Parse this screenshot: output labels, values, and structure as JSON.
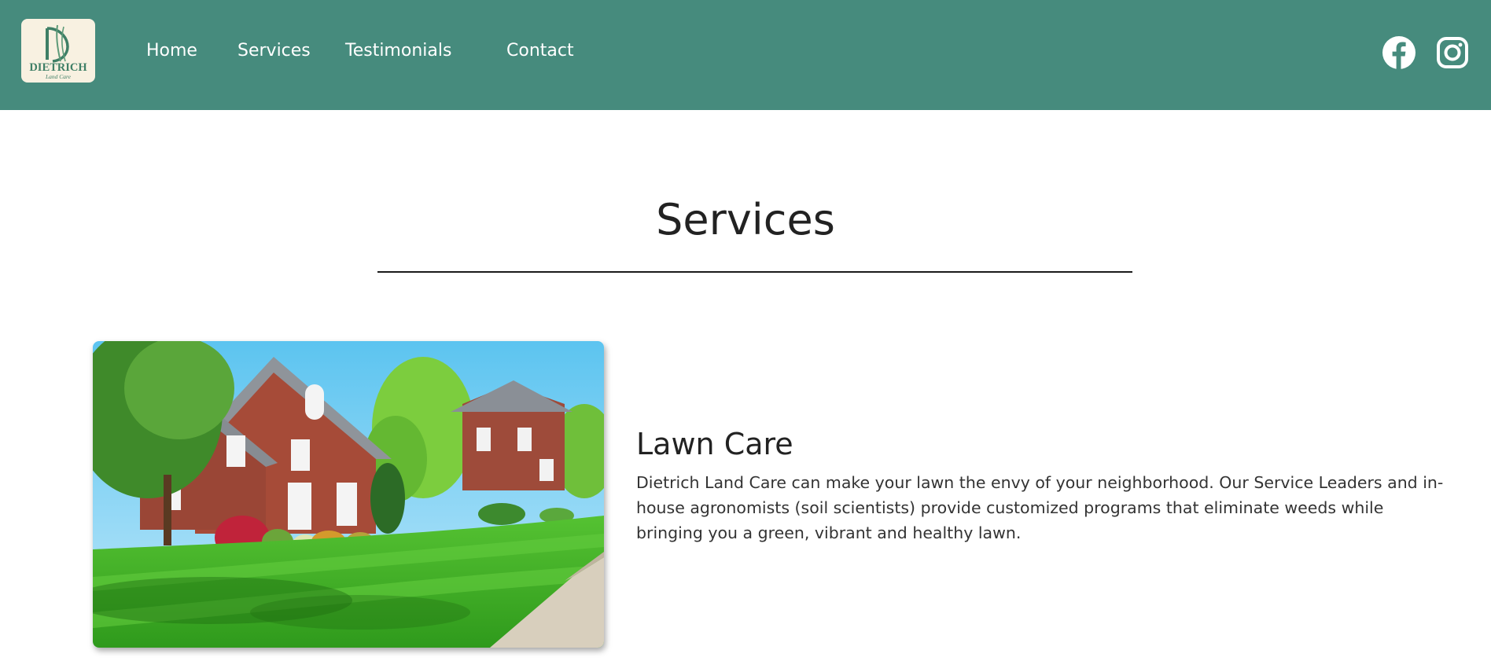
{
  "brand": {
    "logo_name": "DIETRICH",
    "logo_tagline": "Land Care"
  },
  "nav": {
    "items": [
      {
        "label": "Home"
      },
      {
        "label": "Services"
      },
      {
        "label": "Testimonials"
      },
      {
        "label": "Contact"
      }
    ]
  },
  "social": {
    "facebook_icon": "facebook-icon",
    "instagram_icon": "instagram-icon"
  },
  "page": {
    "title": "Services"
  },
  "services": [
    {
      "title": "Lawn Care",
      "description": "Dietrich Land Care can make your lawn the envy of your neighborhood. Our Service Leaders and in-house agronomists (soil scientists) provide customized programs that eliminate weeds while bringing you a green, vibrant and healthy lawn.",
      "image_subject": "brick house with striped green lawn"
    }
  ],
  "colors": {
    "header_background": "#468b7d",
    "nav_text": "#ffffff",
    "page_background": "#ffffff",
    "logo_green": "#3f7f66"
  }
}
